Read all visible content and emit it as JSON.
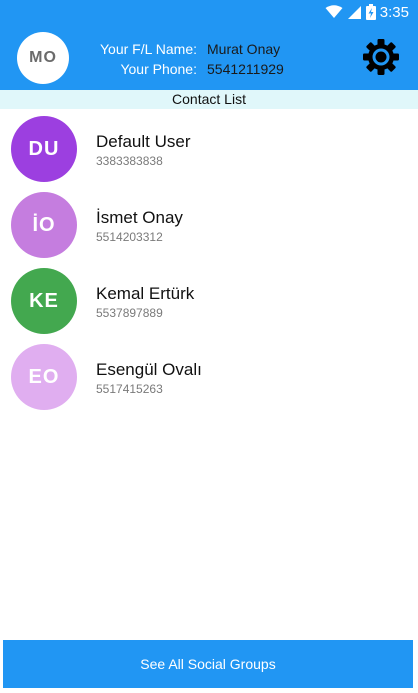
{
  "status_bar": {
    "time": "3:35",
    "icons": [
      "wifi-icon",
      "signal-icon",
      "battery-charging-icon"
    ]
  },
  "header": {
    "avatar_initials": "MO",
    "name_label": "Your F/L Name:",
    "name_value": "Murat Onay",
    "phone_label": "Your Phone:",
    "phone_value": "5541211929",
    "settings_icon": "gear-icon"
  },
  "contact_list": {
    "title": "Contact List",
    "contacts": [
      {
        "initials": "DU",
        "name": "Default User",
        "phone": "3383383838",
        "color": "#9c3fe0"
      },
      {
        "initials": "İO",
        "name": "İsmet Onay",
        "phone": "5514203312",
        "color": "#c57ddf"
      },
      {
        "initials": "KE",
        "name": "Kemal Ertürk",
        "phone": "5537897889",
        "color": "#43a84f"
      },
      {
        "initials": "EO",
        "name": "Esengül Ovalı",
        "phone": "5517415263",
        "color": "#e0aef0"
      }
    ]
  },
  "footer": {
    "button_label": "See All Social Groups"
  },
  "colors": {
    "primary": "#2196f3",
    "section_bg": "#e0f7fa"
  }
}
